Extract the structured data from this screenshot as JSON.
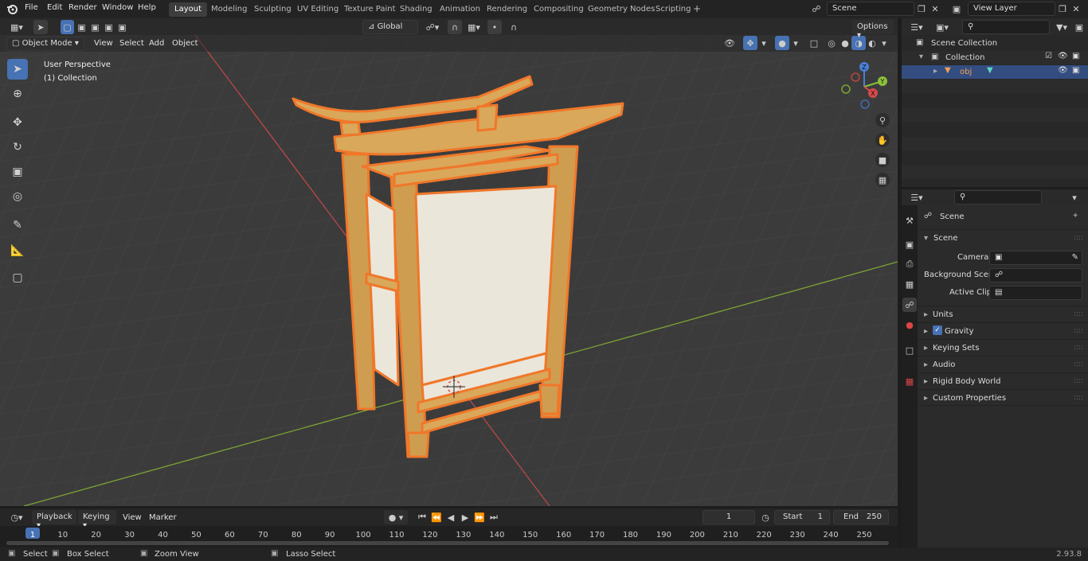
{
  "topbar": {
    "menus": [
      "File",
      "Edit",
      "Render",
      "Window",
      "Help"
    ],
    "workspaces": [
      "Layout",
      "Modeling",
      "Sculpting",
      "UV Editing",
      "Texture Paint",
      "Shading",
      "Animation",
      "Rendering",
      "Compositing",
      "Geometry Nodes",
      "Scripting"
    ],
    "active_workspace": "Layout",
    "add_tab": "+",
    "scene_name": "Scene",
    "view_layer": "View Layer"
  },
  "viewport_header": {
    "mode": "Object Mode",
    "menus": [
      "View",
      "Select",
      "Add",
      "Object"
    ],
    "transform_orientation": "Global",
    "options": "Options"
  },
  "viewport": {
    "perspective": "User Perspective",
    "collection": "(1) Collection",
    "gizmo_axes": [
      "Z",
      "Y",
      "X"
    ]
  },
  "outliner": {
    "scene_collection": "Scene Collection",
    "collection": "Collection",
    "object": "obj"
  },
  "properties": {
    "header": "Scene",
    "panel": "Scene",
    "camera_label": "Camera",
    "background_scene_label": "Background Scene",
    "active_clip_label": "Active Clip",
    "sections": [
      "Units",
      "Gravity",
      "Keying Sets",
      "Audio",
      "Rigid Body World",
      "Custom Properties"
    ]
  },
  "timeline": {
    "menus": [
      "Playback",
      "Keying",
      "View",
      "Marker"
    ],
    "current_frame": "1",
    "start_label": "Start",
    "start": "1",
    "end_label": "End",
    "end": "250",
    "ticks": [
      "1",
      "10",
      "20",
      "30",
      "40",
      "50",
      "60",
      "70",
      "80",
      "90",
      "100",
      "110",
      "120",
      "130",
      "140",
      "150",
      "160",
      "170",
      "180",
      "190",
      "200",
      "210",
      "220",
      "230",
      "240",
      "250"
    ]
  },
  "statusbar": {
    "select": "Select",
    "box_select": "Box Select",
    "zoom_view": "Zoom View",
    "lasso_select": "Lasso Select",
    "version": "2.93.8"
  },
  "colors": {
    "accent": "#4772b3",
    "selection_outline": "#f0772a",
    "wood": "#d9a85a",
    "paper": "#eae6da",
    "x_axis": "#d64a4a",
    "y_axis": "#8cbf3a"
  }
}
